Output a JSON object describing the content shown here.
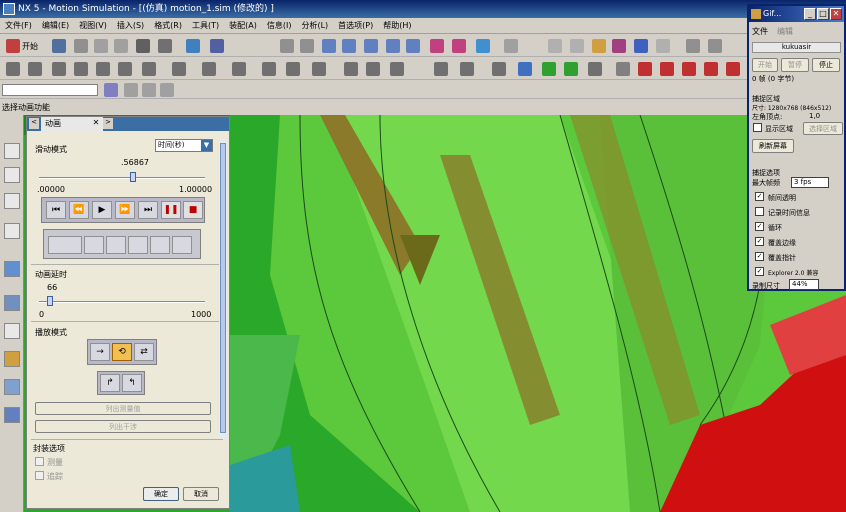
{
  "app": {
    "title": "NX 5 - Motion Simulation - [(仿真) motion_1.sim  (修改的) ]"
  },
  "menu": [
    "文件(F)",
    "编辑(E)",
    "视图(V)",
    "插入(S)",
    "格式(R)",
    "工具(T)",
    "装配(A)",
    "信息(I)",
    "分析(L)",
    "首选项(P)",
    "帮助(H)"
  ],
  "toolbar": {
    "start_label": "开始",
    "filter_label": "选择动画功能"
  },
  "panel": {
    "tab_label": "动画",
    "slide_mode_label": "滑动模式",
    "slide_mode_value": "时间(秒)",
    "time_value": ".56867",
    "time_fraction": 0.56867,
    "time_min": ".00000",
    "time_max": "1.00000",
    "delay_label": "动画延时",
    "delay_value": "66",
    "delay_min": "0",
    "delay_max": "1000",
    "play_mode_label": "播放模式",
    "btn_list_measure": "列出测量值",
    "btn_list_interference": "列出干涉",
    "encap_label": "封装选项",
    "opt_measure": "测量",
    "opt_trace": "追踪",
    "ok": "确定",
    "cancel": "取消"
  },
  "gif": {
    "title": "Gif...",
    "menu_file": "文件",
    "menu_edit": "编辑",
    "user": "kukuasir",
    "btn_start": "开始",
    "btn_pause": "暂停",
    "btn_stop": "停止",
    "frames": "0 帧 (0 字节)",
    "capture_section": "捕捉区域",
    "size": "尺寸: 1280x768 (846x512)",
    "origin_label": "左角顶点:",
    "origin_value": "1,0",
    "show_area": "显示区域",
    "select_area": "选择区域",
    "refresh": "刷新屏幕",
    "options_section": "捕捉选项",
    "max_fps_label": "最大帧频",
    "max_fps_value": "3 fps",
    "opt_transparent": "帧间透明",
    "opt_log_time": "记录时间信息",
    "opt_loop": "循环",
    "opt_cover_border": "覆盖边缘",
    "opt_cover_cursor": "覆盖指针",
    "opt_explorer": "Explorer 2.0 兼容",
    "record_size_label": "录制尺寸",
    "record_size_value": "44%"
  }
}
